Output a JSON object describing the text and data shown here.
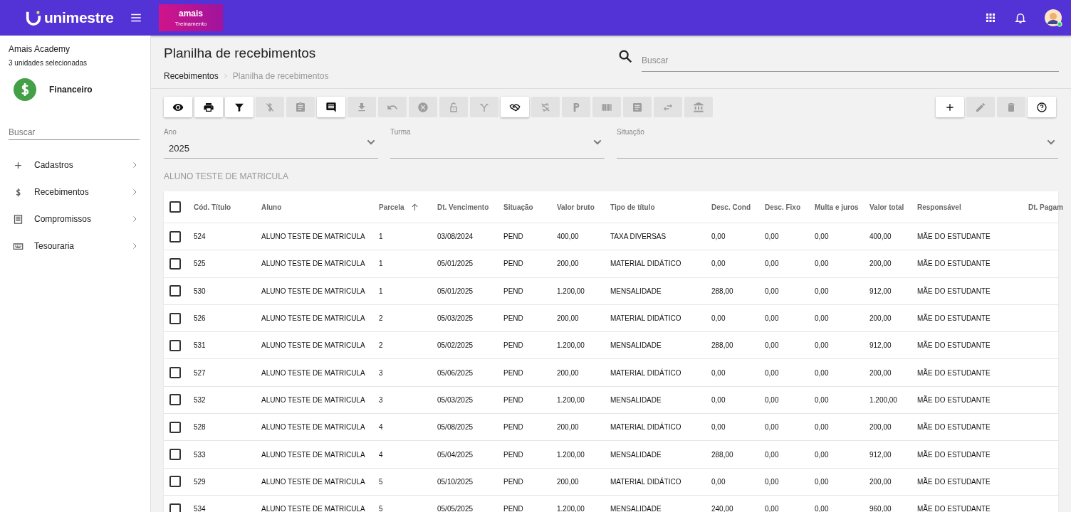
{
  "header": {
    "logo_text": "unimestre",
    "badge": {
      "brand": "amais",
      "label": "Treinamento"
    }
  },
  "sidebar": {
    "organization": "Amais Academy",
    "units": "3 unidades selecionadas",
    "module": "Financeiro",
    "search": {
      "placeholder": "Buscar"
    },
    "items": [
      {
        "label": "Cadastros"
      },
      {
        "label": "Recebimentos"
      },
      {
        "label": "Compromissos"
      },
      {
        "label": "Tesouraria"
      }
    ]
  },
  "page": {
    "title": "Planilha de recebimentos",
    "breadcrumb": [
      "Recebimentos",
      "Planilha de recebimentos"
    ],
    "search": {
      "placeholder": "Buscar"
    }
  },
  "toolbar": [
    {
      "disabled": false
    },
    {
      "disabled": false
    },
    {
      "disabled": false
    },
    {
      "disabled": true
    },
    {
      "disabled": true
    },
    {
      "disabled": false
    },
    {
      "disabled": true
    },
    {
      "disabled": true
    },
    {
      "disabled": true
    },
    {
      "disabled": true
    },
    {
      "disabled": true
    },
    {
      "disabled": false
    },
    {
      "disabled": true
    },
    {
      "disabled": true
    },
    {
      "disabled": true
    },
    {
      "disabled": true
    },
    {
      "disabled": true
    },
    {
      "disabled": true
    }
  ],
  "actions": [
    {
      "disabled": false
    },
    {
      "disabled": true
    },
    {
      "disabled": true
    },
    {
      "disabled": false
    }
  ],
  "filters": [
    {
      "label": "Ano",
      "value": "2025"
    },
    {
      "label": "Turma"
    },
    {
      "label": "Situação"
    }
  ],
  "student": "ALUNO TESTE DE MATRICULA",
  "table": {
    "all_checked": false,
    "columns": [
      "Cód. Título",
      "Aluno",
      "Parcela",
      "Dt. Vencimento",
      "Situação",
      "Valor bruto",
      "Tipo de título",
      "Desc. Cond",
      "Desc. Fixo",
      "Multa e juros",
      "Valor total",
      "Responsável",
      "Dt. Pagam"
    ],
    "rows": [
      {
        "checked": false,
        "cells": [
          "524",
          "ALUNO TESTE DE MATRICULA",
          "1",
          "03/08/2024",
          "PEND",
          "400,00",
          "TAXA DIVERSAS",
          "0,00",
          "0,00",
          "0,00",
          "400,00",
          "MÃE DO ESTUDANTE"
        ]
      },
      {
        "checked": false,
        "cells": [
          "525",
          "ALUNO TESTE DE MATRICULA",
          "1",
          "05/01/2025",
          "PEND",
          "200,00",
          "MATERIAL DIDÁTICO",
          "0,00",
          "0,00",
          "0,00",
          "200,00",
          "MÃE DO ESTUDANTE"
        ]
      },
      {
        "checked": false,
        "cells": [
          "530",
          "ALUNO TESTE DE MATRICULA",
          "1",
          "05/01/2025",
          "PEND",
          "1.200,00",
          "MENSALIDADE",
          "288,00",
          "0,00",
          "0,00",
          "912,00",
          "MÃE DO ESTUDANTE"
        ]
      },
      {
        "checked": false,
        "cells": [
          "526",
          "ALUNO TESTE DE MATRICULA",
          "2",
          "05/03/2025",
          "PEND",
          "200,00",
          "MATERIAL DIDÁTICO",
          "0,00",
          "0,00",
          "0,00",
          "200,00",
          "MÃE DO ESTUDANTE"
        ]
      },
      {
        "checked": false,
        "cells": [
          "531",
          "ALUNO TESTE DE MATRICULA",
          "2",
          "05/02/2025",
          "PEND",
          "1.200,00",
          "MENSALIDADE",
          "288,00",
          "0,00",
          "0,00",
          "912,00",
          "MÃE DO ESTUDANTE"
        ]
      },
      {
        "checked": false,
        "cells": [
          "527",
          "ALUNO TESTE DE MATRICULA",
          "3",
          "05/06/2025",
          "PEND",
          "200,00",
          "MATERIAL DIDÁTICO",
          "0,00",
          "0,00",
          "0,00",
          "200,00",
          "MÃE DO ESTUDANTE"
        ]
      },
      {
        "checked": false,
        "cells": [
          "532",
          "ALUNO TESTE DE MATRICULA",
          "3",
          "05/03/2025",
          "PEND",
          "1.200,00",
          "MENSALIDADE",
          "0,00",
          "0,00",
          "0,00",
          "1.200,00",
          "MÃE DO ESTUDANTE"
        ]
      },
      {
        "checked": false,
        "cells": [
          "528",
          "ALUNO TESTE DE MATRICULA",
          "4",
          "05/08/2025",
          "PEND",
          "200,00",
          "MATERIAL DIDÁTICO",
          "0,00",
          "0,00",
          "0,00",
          "200,00",
          "MÃE DO ESTUDANTE"
        ]
      },
      {
        "checked": false,
        "cells": [
          "533",
          "ALUNO TESTE DE MATRICULA",
          "4",
          "05/04/2025",
          "PEND",
          "1.200,00",
          "MENSALIDADE",
          "288,00",
          "0,00",
          "0,00",
          "912,00",
          "MÃE DO ESTUDANTE"
        ]
      },
      {
        "checked": false,
        "cells": [
          "529",
          "ALUNO TESTE DE MATRICULA",
          "5",
          "05/10/2025",
          "PEND",
          "200,00",
          "MATERIAL DIDÁTICO",
          "0,00",
          "0,00",
          "0,00",
          "200,00",
          "MÃE DO ESTUDANTE"
        ]
      },
      {
        "checked": false,
        "cells": [
          "534",
          "ALUNO TESTE DE MATRICULA",
          "5",
          "05/05/2025",
          "PEND",
          "1.200,00",
          "MENSALIDADE",
          "240,00",
          "0,00",
          "0,00",
          "960,00",
          "MÃE DO ESTUDANTE"
        ]
      }
    ]
  }
}
